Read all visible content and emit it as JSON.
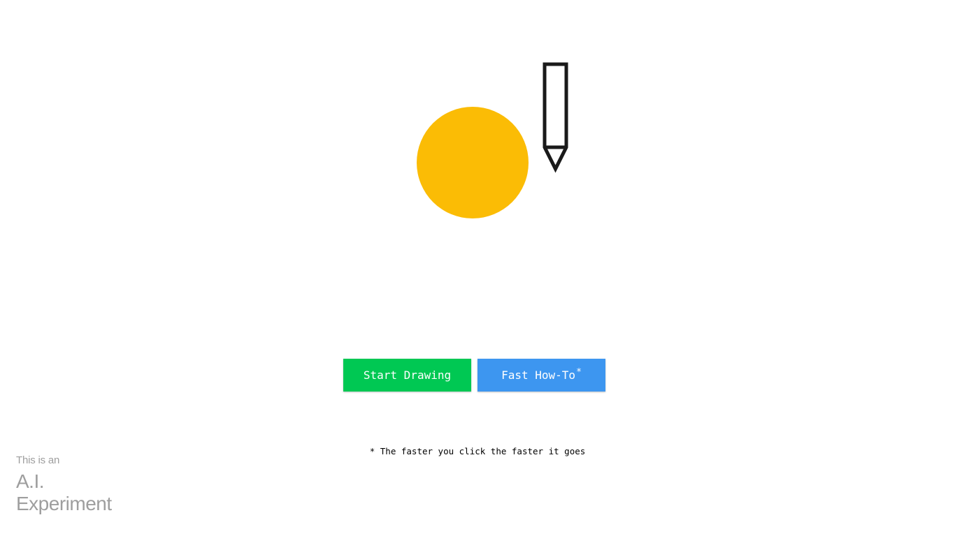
{
  "illustration": {
    "circle_color": "#FBBC05",
    "pencil_icon": "pencil-icon"
  },
  "buttons": {
    "start_label": "Start Drawing",
    "start_color": "#00C853",
    "howto_label": "Fast How-To",
    "howto_marker": "*",
    "howto_color": "#3D96F0"
  },
  "footnote": "* The faster you click the faster it goes",
  "badge": {
    "line1": "This is an",
    "line2": "A.I.",
    "line3": "Experiment"
  }
}
